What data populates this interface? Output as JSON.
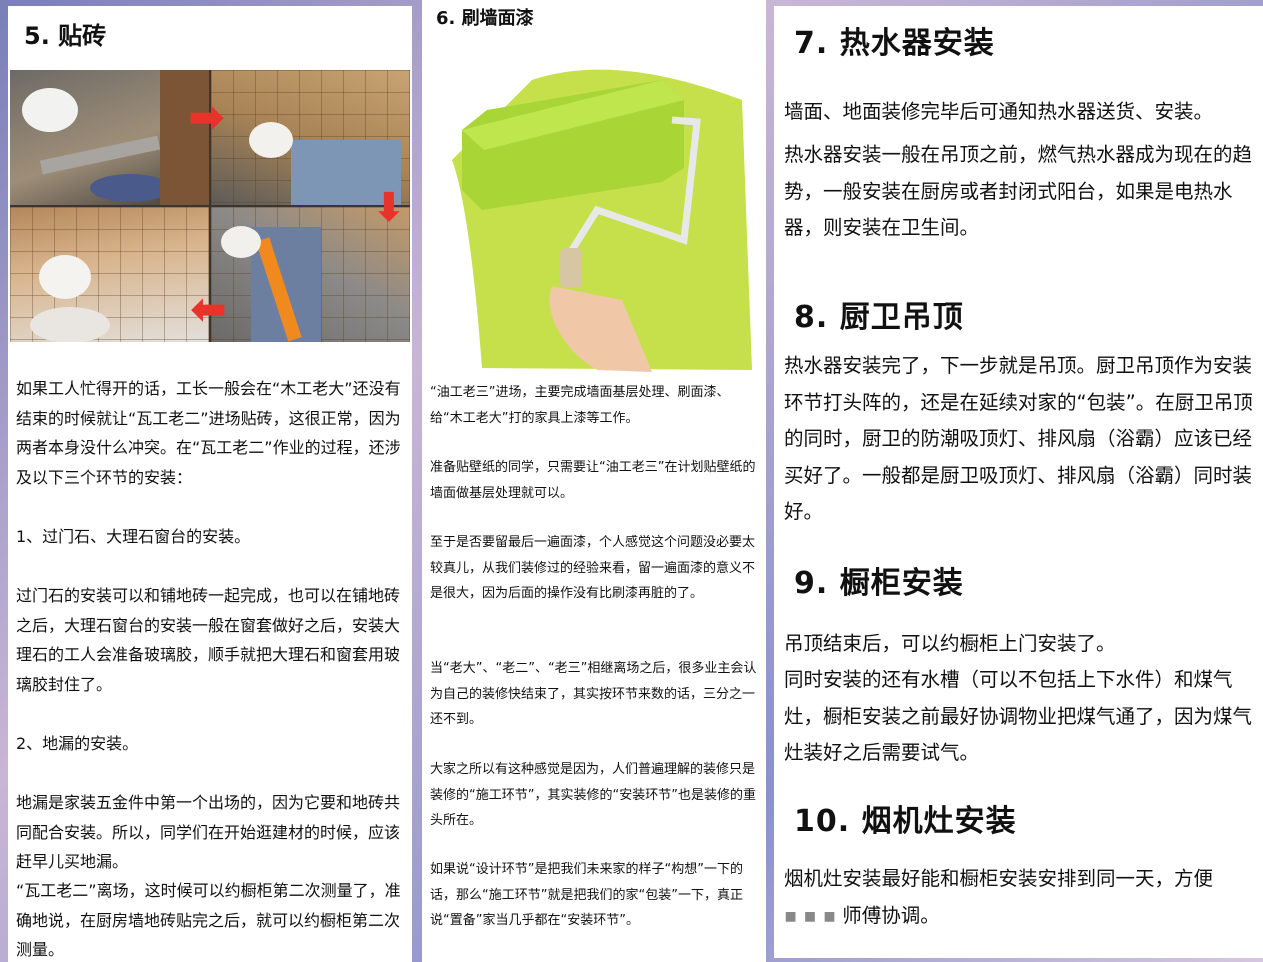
{
  "panel1": {
    "heading": "5. 贴砖",
    "paragraphs": [
      "如果工人忙得开的话，工长一般会在“木工老大”还没有结束的时候就让“瓦工老二”进场贴砖，这很正常，因为两者本身没什么冲突。在“瓦工老二”作业的过程，还涉及以下三个环节的安装：",
      "1、过门石、大理石窗台的安装。",
      "过门石的安装可以和铺地砖一起完成，也可以在铺地砖之后，大理石窗台的安装一般在窗套做好之后，安装大理石的工人会准备玻璃胶，顺手就把大理石和窗套用玻璃胶封住了。",
      "2、地漏的安装。",
      "地漏是家装五金件中第一个出场的，因为它要和地砖共同配合安装。所以，同学们在开始逛建材的时候，应该赶早儿买地漏。",
      "“瓦工老二”离场，这时候可以约橱柜第二次测量了，准确地说，在厨房墙地砖贴完之后，就可以约橱柜第二次测量。"
    ]
  },
  "panel2": {
    "heading": "6. 刷墙面漆",
    "paragraphs": [
      "“油工老三”进场，主要完成墙面基层处理、刷面漆、给“木工老大”打的家具上漆等工作。",
      "准备贴壁纸的同学，只需要让“油工老三”在计划贴壁纸的墙面做基层处理就可以。",
      "至于是否要留最后一遍面漆，个人感觉这个问题没必要太较真儿，从我们装修过的经验来看，留一遍面漆的意义不是很大，因为后面的操作没有比刷漆再脏的了。",
      "当“老大”、“老二”、“老三”相继离场之后，很多业主会认为自己的装修快结束了，其实按环节来数的话，三分之一还不到。",
      "大家之所以有这种感觉是因为，人们普遍理解的装修只是装修的“施工环节”，其实装修的“安装环节”也是装修的重头所在。",
      "如果说“设计环节”是把我们未来家的样子“构想”一下的话，那么“施工环节”就是把我们的家“包装”一下，真正说“置备”家当几乎都在“安装环节”。"
    ]
  },
  "panel3": {
    "sections": [
      {
        "heading": "7. 热水器安装",
        "paragraphs": [
          "墙面、地面装修完毕后可通知热水器送货、安装。",
          "热水器安装一般在吊顶之前，燃气热水器成为现在的趋势，一般安装在厨房或者封闭式阳台，如果是电热水器，则安装在卫生间。"
        ]
      },
      {
        "heading": "8. 厨卫吊顶",
        "paragraphs": [
          "热水器安装完了，下一步就是吊顶。厨卫吊顶作为安装环节打头阵的，还是在延续对家的“包装”。在厨卫吊顶的同时，厨卫的防潮吸顶灯、排风扇（浴霸）应该已经买好了。一般都是厨卫吸顶灯、排风扇（浴霸）同时装好。"
        ]
      },
      {
        "heading": "9. 橱柜安装",
        "paragraphs": [
          "吊顶结束后，可以约橱柜上门安装了。",
          "同时安装的还有水槽（可以不包括上下水件）和煤气灶，橱柜安装之前最好协调物业把煤气通了，因为煤气灶装好之后需要试气。"
        ]
      },
      {
        "heading": "10. 烟机灶安装",
        "paragraphs": [
          "烟机灶安装最好能和橱柜安装安排到同一天，方便"
        ],
        "cut_line": "师傅协调。"
      }
    ]
  }
}
